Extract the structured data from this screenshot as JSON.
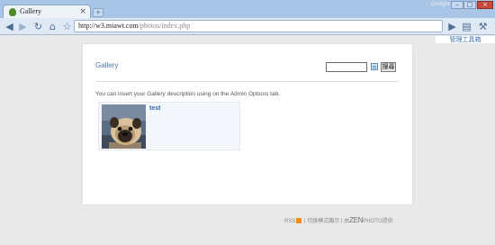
{
  "browser": {
    "tab_title": "Gallery",
    "tab_close": "×",
    "new_tab": "+",
    "google_label": "Google",
    "window_buttons": {
      "minimize": "–",
      "maximize": "□",
      "close": "×"
    },
    "url_domain": "http://w3.miawt.com",
    "url_path": "/photos/index.php",
    "icons": [
      "back-icon",
      "forward-icon",
      "reload-icon",
      "home-icon",
      "star-icon",
      "go-icon",
      "page-menu-icon",
      "wrench-menu-icon"
    ]
  },
  "adminbar": {
    "label": "管理工具箱"
  },
  "gallery": {
    "title": "Gallery",
    "search_button": "搜尋",
    "description": "You can insert your Gallery description using on the Admin Options tab.",
    "albums": [
      {
        "title": "test"
      }
    ]
  },
  "footer": {
    "rss": "RSS",
    "separator_1": " | ",
    "mode": "切換模式顯示",
    "separator_2": " | 由",
    "zen": "ZEN",
    "photo": "PHOTO",
    "powered": "提供"
  },
  "colors": {
    "accent": "#4d78a8",
    "link": "#2f6aa8",
    "chrome": "#a9c5e6"
  }
}
